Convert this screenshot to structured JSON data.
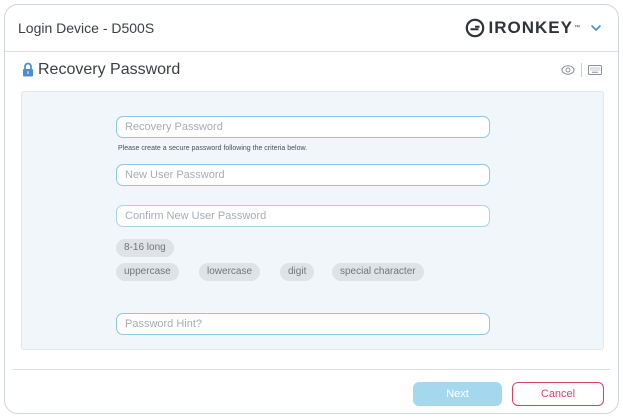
{
  "window": {
    "title": "Login Device - D500S",
    "brand": {
      "name": "IRONKEY",
      "trademark": "™"
    }
  },
  "section": {
    "title": "Recovery Password"
  },
  "form": {
    "recovery_password": {
      "placeholder": "Recovery Password",
      "value": ""
    },
    "helper_text": "Please create a secure password following the criteria below.",
    "new_password": {
      "placeholder": "New User Password",
      "value": ""
    },
    "confirm_password": {
      "placeholder": "Confirm New User Password",
      "value": ""
    },
    "criteria": {
      "length": "8-16 long",
      "uppercase": "uppercase",
      "lowercase": "lowercase",
      "digit": "digit",
      "special": "special character"
    },
    "hint": {
      "placeholder": "Password Hint?",
      "value": ""
    }
  },
  "footer": {
    "next_label": "Next",
    "cancel_label": "Cancel"
  },
  "colors": {
    "accent": "#8ec9e0",
    "next_button": "#a5d8ee",
    "cancel": "#d6455f",
    "lock_icon": "#4a8fd6",
    "panel_bg": "#f1f6fa"
  },
  "icons": [
    "ironkey-logo-icon",
    "chevron-down-icon",
    "lock-icon",
    "eye-icon",
    "keyboard-icon"
  ]
}
